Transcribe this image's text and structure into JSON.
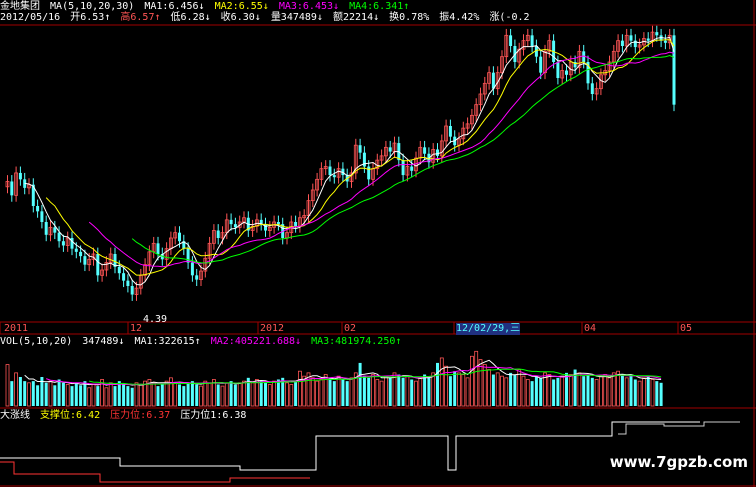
{
  "header": {
    "stock_name": "金地集团",
    "ma_title": "MA(5,10,20,30)",
    "ma1": "MA1:6.456↓",
    "ma2": "MA2:6.55↓",
    "ma3": "MA3:6.453↓",
    "ma4": "MA4:6.341↑",
    "date": "2012/05/16",
    "open": "开6.53↑",
    "high": "高6.57↑",
    "low": "低6.28↓",
    "close": "收6.30↓",
    "volume": "量347489↓",
    "amount": "额22214↓",
    "turnover": "换0.78%",
    "amplitude": "振4.42%",
    "change": "涨(-0.2"
  },
  "axis": {
    "labels": [
      "2011",
      "12",
      "2012",
      "02",
      "12/02/29,三",
      "04",
      "05"
    ],
    "low_marker": "4.39"
  },
  "volume_panel": {
    "title": "VOL(5,10,20)",
    "vol": "347489↓",
    "ma1": "MA1:322615↑",
    "ma2": "MA2:405221.688↓",
    "ma3": "MA3:481974.250↑"
  },
  "indicator_panel": {
    "name": "大涨线",
    "support": "支撑位:6.42",
    "resistance_red": "压力位:6.37",
    "resistance_white": "压力位1:6.38"
  },
  "watermark": "www.7gpzb.com",
  "colors": {
    "up": "#ff5555",
    "down": "#55ffff",
    "ma1": "#ffffff",
    "ma2": "#ffff00",
    "ma3": "#ff00ff",
    "ma4": "#00ff00",
    "grid": "#a00000"
  },
  "chart_data": {
    "type": "candlestick",
    "closes": [
      5.58,
      5.45,
      5.66,
      5.6,
      5.52,
      5.55,
      5.35,
      5.3,
      5.2,
      5.08,
      5.15,
      5.1,
      5.02,
      4.98,
      5.05,
      4.95,
      4.92,
      4.88,
      4.8,
      4.85,
      4.9,
      4.7,
      4.75,
      4.82,
      4.9,
      4.78,
      4.72,
      4.65,
      4.6,
      4.52,
      4.58,
      4.7,
      4.8,
      4.92,
      5.0,
      4.9,
      4.85,
      4.95,
      5.05,
      5.1,
      5.02,
      4.95,
      4.82,
      4.7,
      4.66,
      4.74,
      4.86,
      5.0,
      5.12,
      5.05,
      5.1,
      5.22,
      5.18,
      5.15,
      5.2,
      5.24,
      5.12,
      5.16,
      5.22,
      5.18,
      5.12,
      5.15,
      5.2,
      5.18,
      5.05,
      5.1,
      5.2,
      5.16,
      5.24,
      5.26,
      5.4,
      5.5,
      5.6,
      5.7,
      5.72,
      5.64,
      5.62,
      5.7,
      5.64,
      5.58,
      5.66,
      5.92,
      5.85,
      5.72,
      5.6,
      5.7,
      5.78,
      5.82,
      5.9,
      5.86,
      5.94,
      5.78,
      5.64,
      5.72,
      5.68,
      5.8,
      5.9,
      5.84,
      5.76,
      5.88,
      5.82,
      5.96,
      6.1,
      6.0,
      5.92,
      5.98,
      6.08,
      6.12,
      6.2,
      6.3,
      6.4,
      6.5,
      6.6,
      6.45,
      6.6,
      6.75,
      6.95,
      6.85,
      6.7,
      6.82,
      6.9,
      6.95,
      6.85,
      6.75,
      6.6,
      6.8,
      6.9,
      6.7,
      6.55,
      6.62,
      6.58,
      6.7,
      6.65,
      6.8,
      6.7,
      6.5,
      6.4,
      6.45,
      6.58,
      6.62,
      6.7,
      6.8,
      6.9,
      6.85,
      6.95,
      6.9,
      6.84,
      6.86,
      6.92,
      6.9,
      6.98,
      6.95,
      6.9,
      6.88,
      6.95,
      6.3
    ],
    "volumes": [
      50,
      30,
      40,
      35,
      30,
      28,
      30,
      25,
      35,
      28,
      30,
      25,
      32,
      28,
      26,
      24,
      28,
      25,
      30,
      22,
      26,
      24,
      32,
      22,
      28,
      24,
      30,
      26,
      24,
      22,
      28,
      26,
      30,
      32,
      28,
      24,
      26,
      30,
      34,
      28,
      26,
      24,
      28,
      30,
      26,
      24,
      30,
      28,
      32,
      26,
      24,
      28,
      30,
      26,
      28,
      30,
      34,
      28,
      32,
      30,
      28,
      26,
      30,
      32,
      34,
      28,
      26,
      30,
      42,
      36,
      40,
      34,
      30,
      32,
      38,
      34,
      30,
      36,
      32,
      30,
      34,
      40,
      52,
      36,
      34,
      38,
      32,
      30,
      36,
      34,
      40,
      38,
      34,
      36,
      32,
      30,
      34,
      38,
      36,
      40,
      52,
      58,
      48,
      36,
      42,
      40,
      38,
      34,
      60,
      66,
      56,
      50,
      44,
      38,
      40,
      36,
      34,
      40,
      38,
      44,
      36,
      32,
      30,
      36,
      34,
      40,
      38,
      32,
      34,
      36,
      40,
      38,
      44,
      40,
      36,
      38,
      34,
      32,
      36,
      38,
      34,
      40,
      42,
      38,
      34,
      36,
      32,
      30,
      34,
      36,
      32,
      30,
      28
    ]
  }
}
